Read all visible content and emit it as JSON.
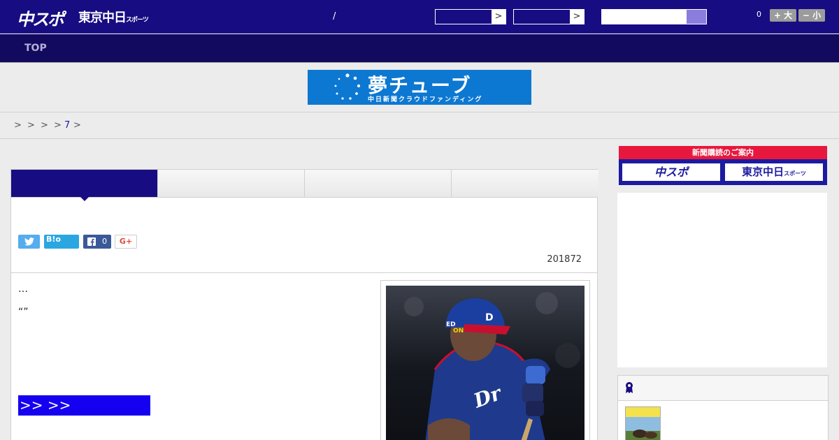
{
  "header": {
    "logo_chuspo": "中スポ",
    "logo_tokyo": "東京中日",
    "logo_tokyo_small": "スポーツ",
    "separator": "/",
    "dropdown_arrow": ">",
    "fontsize_count": "0",
    "fontsize_up": "+ 大",
    "fontsize_down": "− 小"
  },
  "nav": {
    "top_label": "TOP"
  },
  "banner": {
    "title": "夢チューブ",
    "subtitle": "中日新聞クラウドファンディング"
  },
  "breadcrumb": {
    "sep1": ">",
    "sep2": ">",
    "sep3": ">",
    "sep4": ">",
    "current": "7",
    "sep5": ">"
  },
  "article": {
    "share_hatena": "B!o",
    "share_fb_count": "0",
    "share_gplus": "G+",
    "date": "201872",
    "text1": "…",
    "text2": "“”",
    "link_text": ">> >>"
  },
  "sidebar": {
    "subscribe_head": "新聞購読のご案内",
    "subscribe_chuspo": "中スポ",
    "subscribe_tokyo": "東京中日",
    "subscribe_tokyo_small": "スポーツ"
  },
  "colors": {
    "header_bg": "#180c82",
    "nav_bg": "#120a5e",
    "accent_red": "#e8173d",
    "link_box": "#1600f0"
  }
}
